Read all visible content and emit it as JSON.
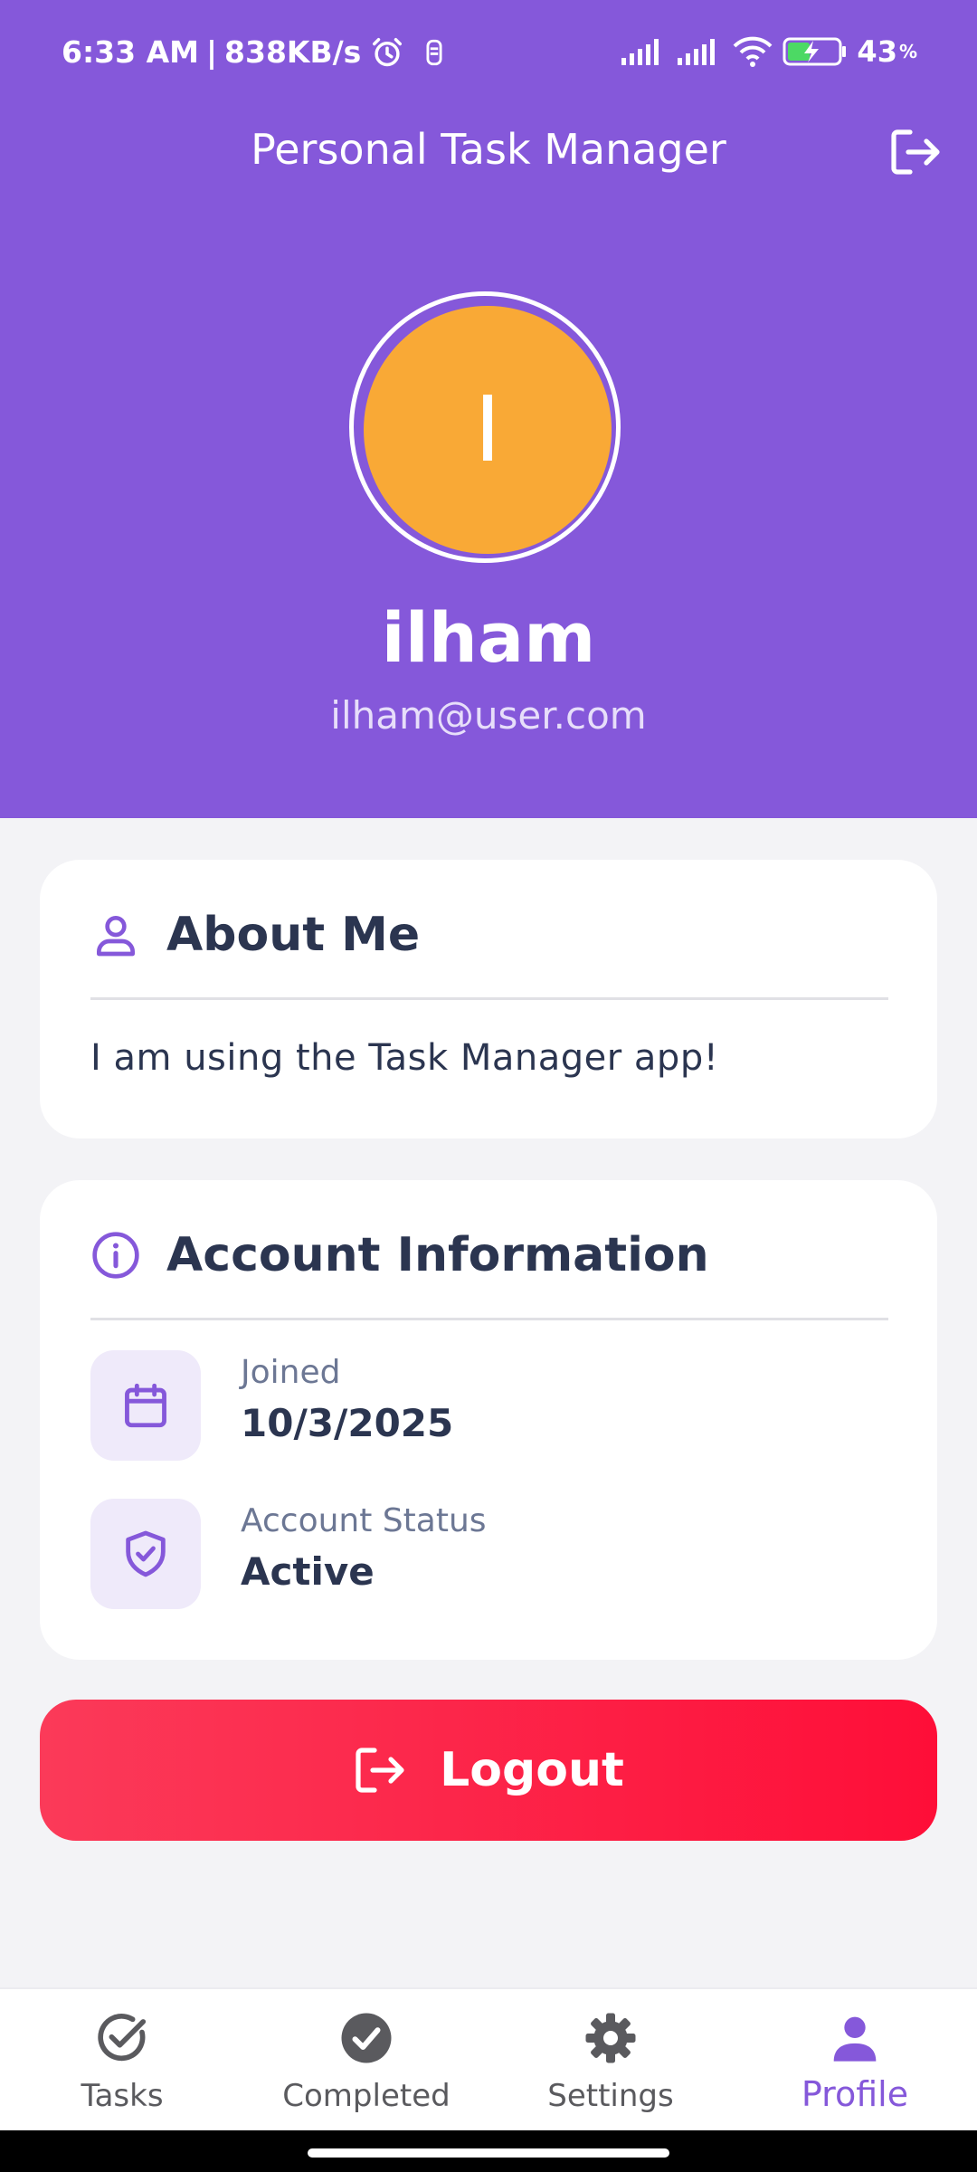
{
  "status_bar": {
    "time": "6:33 AM",
    "separator": "|",
    "net_speed": "838KB/s",
    "battery_level": "43",
    "battery_unit": "%"
  },
  "app_bar": {
    "title": "Personal Task Manager"
  },
  "profile": {
    "avatar_initial": "I",
    "name": "ilham",
    "email": "ilham@user.com",
    "avatar_color": "#f9a936"
  },
  "about": {
    "title": "About Me",
    "text": "I am using the Task Manager app!"
  },
  "account": {
    "title": "Account Information",
    "rows": [
      {
        "label": "Joined",
        "value": "10/3/2025",
        "icon": "calendar-icon"
      },
      {
        "label": "Account Status",
        "value": "Active",
        "icon": "shield-check-icon"
      }
    ]
  },
  "logout_button": {
    "label": "Logout"
  },
  "bottom_nav": {
    "items": [
      {
        "label": "Tasks",
        "icon": "check-circle-outline-icon",
        "active": false
      },
      {
        "label": "Completed",
        "icon": "check-circle-filled-icon",
        "active": false
      },
      {
        "label": "Settings",
        "icon": "gear-icon",
        "active": false
      },
      {
        "label": "Profile",
        "icon": "person-icon",
        "active": true
      }
    ]
  },
  "colors": {
    "brand_purple": "#8558da",
    "logout_red": "#fe0e38",
    "text_dark": "#2b3550"
  }
}
